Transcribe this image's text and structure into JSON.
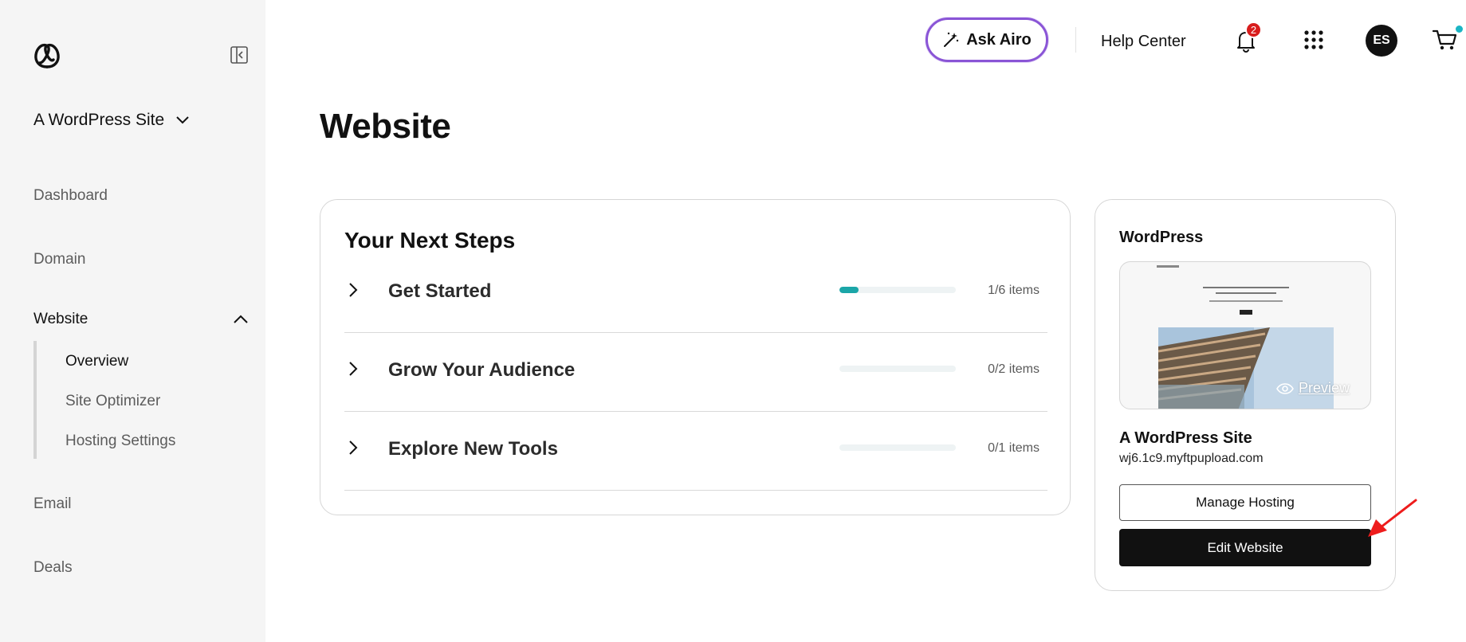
{
  "sidebar": {
    "site_name": "A WordPress Site",
    "nav": {
      "dashboard": "Dashboard",
      "domain": "Domain",
      "website": "Website",
      "email": "Email",
      "deals": "Deals"
    },
    "website_sub": {
      "overview": "Overview",
      "site_optimizer": "Site Optimizer",
      "hosting_settings": "Hosting Settings"
    }
  },
  "topbar": {
    "ask_airo": "Ask Airo",
    "help_center": "Help Center",
    "notification_count": "2",
    "avatar_initials": "ES"
  },
  "page_title": "Website",
  "next_steps": {
    "title": "Your Next Steps",
    "items": [
      {
        "label": "Get Started",
        "count": "1/6 items",
        "progress": 0.167
      },
      {
        "label": "Grow Your Audience",
        "count": "0/2 items",
        "progress": 0
      },
      {
        "label": "Explore New Tools",
        "count": "0/1 items",
        "progress": 0
      }
    ]
  },
  "wordpress_card": {
    "label": "WordPress",
    "preview_label": "Preview",
    "site_name": "A WordPress Site",
    "site_url": "wj6.1c9.myftpupload.com",
    "manage_hosting": "Manage Hosting",
    "edit_website": "Edit Website"
  },
  "colors": {
    "accent_purple": "#8a55d6",
    "progress_teal": "#1ba6a8",
    "badge_red": "#d81d1d",
    "cart_dot": "#1bb5c4",
    "annotation_red": "#ee1c1c"
  }
}
